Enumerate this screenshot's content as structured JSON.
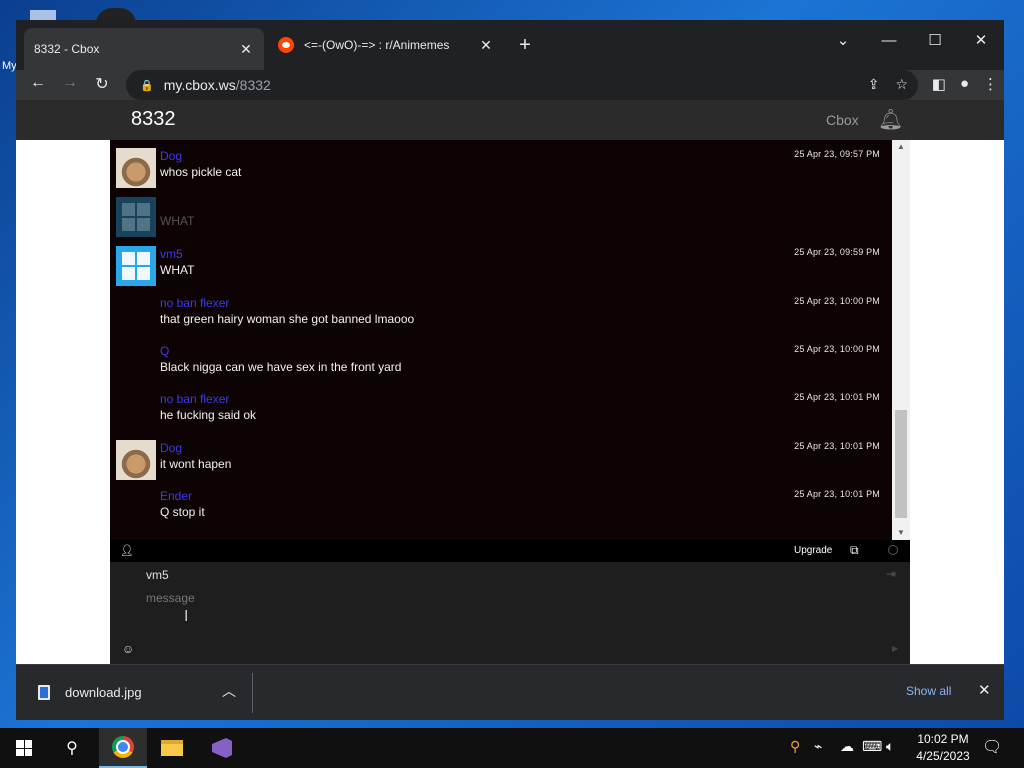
{
  "browser": {
    "tabs": [
      {
        "title": "8332 - Cbox",
        "active": true
      },
      {
        "title": "<=-(OwO)-=> : r/Animemes",
        "active": false
      }
    ],
    "new_tab": "+",
    "window_controls": {
      "list": "⌄",
      "minimize": "—",
      "maximize": "☐",
      "close": "✕"
    },
    "url_host": "my.cbox.ws",
    "url_path": "/8332",
    "nav": {
      "back": "←",
      "forward": "→",
      "reload": "↻"
    }
  },
  "cbox": {
    "title": "8332",
    "brand_link": "Cbox",
    "messages": [
      {
        "name": "Dog",
        "text": "whos pickle cat",
        "time": "25 Apr 23, 09:57 PM",
        "avatar": "dog-photo"
      },
      {
        "name": "",
        "text": "WHAT",
        "time": "",
        "avatar": "windows-logo"
      },
      {
        "name": "vm5",
        "text": "WHAT",
        "time": "25 Apr 23, 09:59 PM",
        "avatar": "windows-logo"
      },
      {
        "name": "no ban flexer",
        "text": "that green hairy woman she got banned lmaooo",
        "time": "25 Apr 23, 10:00 PM",
        "avatar": "none"
      },
      {
        "name": "Q",
        "text": "Black nigga can we have sex in the front yard",
        "time": "25 Apr 23, 10:00 PM",
        "avatar": "none"
      },
      {
        "name": "no ban flexer",
        "text": "he fucking said ok",
        "time": "25 Apr 23, 10:01 PM",
        "avatar": "none"
      },
      {
        "name": "Dog",
        "text": "it wont hapen",
        "time": "25 Apr 23, 10:01 PM",
        "avatar": "dog-photo"
      },
      {
        "name": "Ender",
        "text": "Q stop it",
        "time": "25 Apr 23, 10:01 PM",
        "avatar": "none"
      }
    ],
    "upgrade_label": "Upgrade",
    "compose": {
      "username": "vm5",
      "placeholder": "message",
      "value": ""
    }
  },
  "downloads": {
    "file_name": "download.jpg",
    "show_all": "Show all"
  },
  "taskbar": {
    "time": "10:02 PM",
    "date": "4/25/2023",
    "apps": [
      "start",
      "search",
      "chrome",
      "file-explorer",
      "visual-studio"
    ]
  },
  "desktop": {
    "label": "My"
  },
  "colors": {
    "username": "#3a3af2",
    "chat_bg": "#0e0303",
    "show_all": "#8ab4f8"
  }
}
